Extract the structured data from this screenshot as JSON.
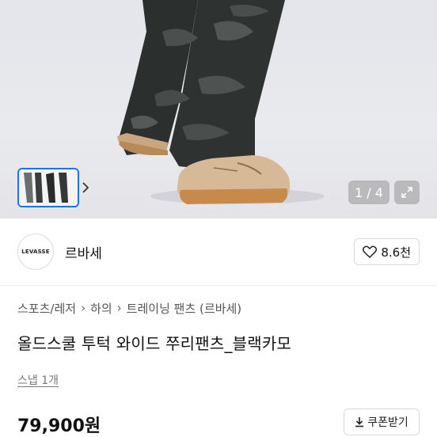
{
  "gallery": {
    "current_page": "1",
    "separator": "/",
    "total_pages": "4"
  },
  "brand": {
    "logo_text": "LEVASSE",
    "name": "르바세",
    "like_count": "8.6천"
  },
  "breadcrumb": {
    "items": [
      "스포츠/레저",
      "하의",
      "트레이닝 팬츠 (르바세)"
    ],
    "separator": "›"
  },
  "product": {
    "title": "올드스쿨 투턱 와이드 쭈리팬츠_블랙카모",
    "snap_link": "스냅 1개",
    "price": "79,900원"
  },
  "coupon": {
    "label": "쿠폰받기"
  },
  "icons": {
    "heart": "heart-icon",
    "expand": "expand-icon",
    "download": "download-icon",
    "chevron": "chevron-right-icon"
  }
}
